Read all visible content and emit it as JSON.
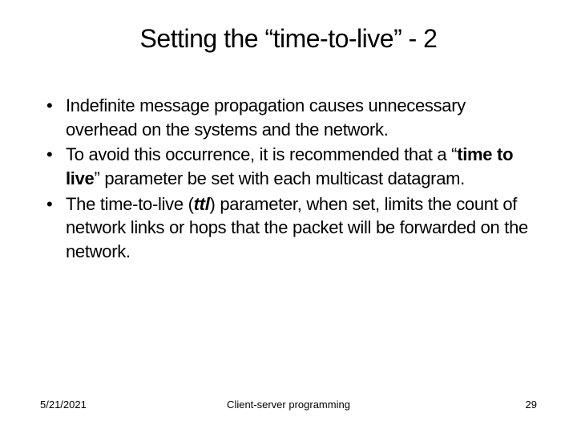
{
  "slide": {
    "title": "Setting the “time-to-live” - 2",
    "bullets": [
      {
        "pre": "Indefinite message propagation causes unnecessary overhead on the systems and the network."
      },
      {
        "pre": "To avoid this occurrence, it is recommended that a “",
        "strong1": "time to live",
        "mid": "” parameter be set with each multicast datagram."
      },
      {
        "pre": "The time-to-live (",
        "emstrong": "ttl",
        "mid": ") parameter, when set, limits the count of network links or hops that the packet will be forwarded on the network."
      }
    ]
  },
  "footer": {
    "date": "5/21/2021",
    "center": "Client-server programming",
    "page": "29"
  }
}
